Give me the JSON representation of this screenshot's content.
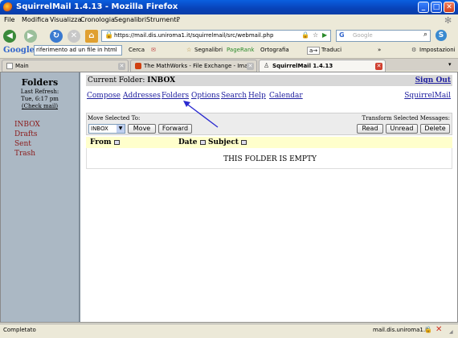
{
  "window": {
    "title": "SquirrelMail 1.4.13 - Mozilla Firefox",
    "controls": {
      "minimize": "_",
      "maximize": "□",
      "close": "✕"
    }
  },
  "menubar": {
    "items": [
      "File",
      "Modifica",
      "Visualizza",
      "Cronologia",
      "Segnalibri",
      "Strumenti",
      "?"
    ]
  },
  "navbar": {
    "url": "https://mail.dis.uniroma1.it/squirrelmail/src/webmail.php",
    "search_placeholder": "Google",
    "search_engine": "G"
  },
  "google_toolbar": {
    "logo": "Google",
    "search_value": "riferimento ad un file in html",
    "cerca": "Cerca",
    "segnalibri": "Segnalibri",
    "pagerank": "PageRank",
    "ortografia": "Ortografia",
    "traduci": "Traduci",
    "more": "»",
    "impostazioni": "Impostazioni"
  },
  "tabs": [
    {
      "label": "Main",
      "active": false
    },
    {
      "label": "The MathWorks - File Exchange - Ima...",
      "active": false
    },
    {
      "label": "SquirrelMail 1.4.13",
      "active": true
    }
  ],
  "sidebar": {
    "title": "Folders",
    "last_refresh_label": "Last Refresh:",
    "last_refresh_time": "Tue, 6:17 pm",
    "check_mail": "(Check mail)",
    "folders": [
      "INBOX",
      "Drafts",
      "Sent",
      "Trash"
    ]
  },
  "main": {
    "current_folder_label": "Current Folder:",
    "current_folder": "INBOX",
    "sign_out": "Sign Out",
    "nav_links": [
      "Compose",
      "Addresses",
      "Folders",
      "Options",
      "Search",
      "Help",
      "Calendar"
    ],
    "squirrelmail_link": "SquirrelMail",
    "move_selected_label": "Move Selected To:",
    "transform_label": "Transform Selected Messages:",
    "move_target": "INBOX",
    "buttons": {
      "move": "Move",
      "forward": "Forward",
      "read": "Read",
      "unread": "Unread",
      "delete": "Delete"
    },
    "columns": [
      "From",
      "Date",
      "Subject"
    ],
    "empty_message": "THIS FOLDER IS EMPTY"
  },
  "statusbar": {
    "status": "Completato",
    "domain": "mail.dis.uniroma1.it"
  },
  "colors": {
    "sidebar_bg": "#abb8c4",
    "folder_link": "#8b1a1a",
    "link": "#2020a0",
    "header_row": "#ffffcc",
    "annotation_arrow": "#2a2ad0"
  }
}
